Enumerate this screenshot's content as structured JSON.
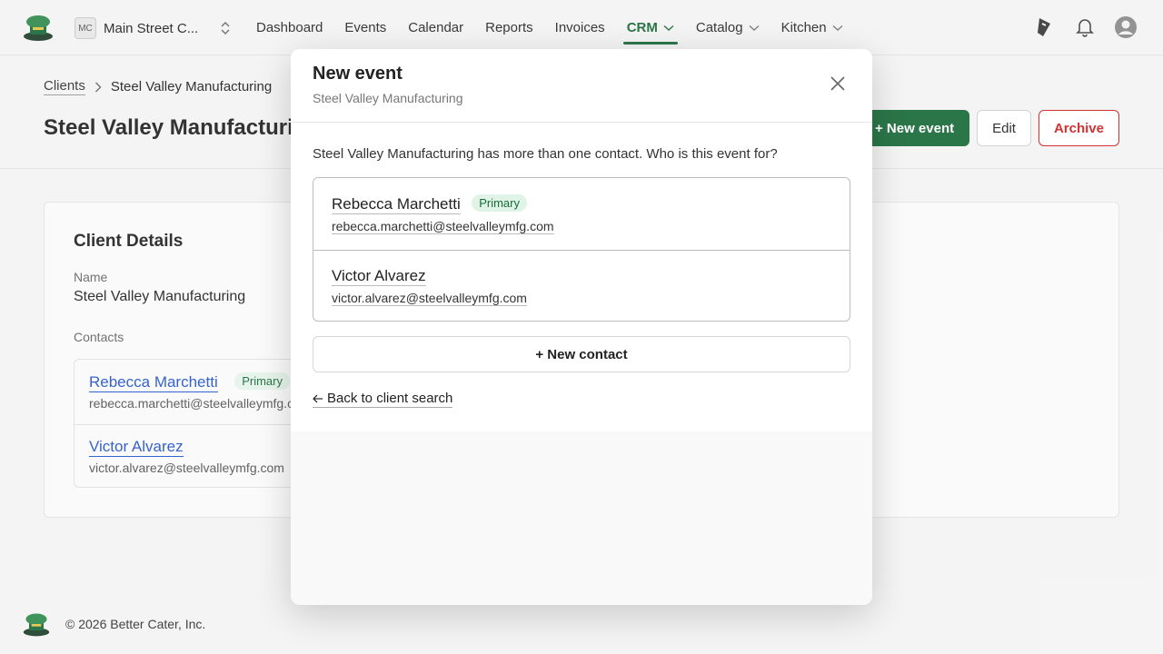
{
  "app": {
    "org_badge": "MC",
    "org_name": "Main Street C...",
    "footer_text": "© 2026 Better Cater, Inc."
  },
  "nav": {
    "items": [
      {
        "label": "Dashboard"
      },
      {
        "label": "Events"
      },
      {
        "label": "Calendar"
      },
      {
        "label": "Reports"
      },
      {
        "label": "Invoices"
      },
      {
        "label": "CRM"
      },
      {
        "label": "Catalog"
      },
      {
        "label": "Kitchen"
      }
    ],
    "active": "CRM"
  },
  "breadcrumb": {
    "parent": "Clients",
    "current": "Steel Valley Manufacturing"
  },
  "page": {
    "title": "Steel Valley Manufacturing",
    "actions": {
      "new_event": "+ New event",
      "edit": "Edit",
      "archive": "Archive"
    }
  },
  "client_card": {
    "title": "Client Details",
    "name_label": "Name",
    "name_value": "Steel Valley Manufacturing",
    "contacts_label": "Contacts",
    "contacts": [
      {
        "name": "Rebecca Marchetti",
        "badge": "Primary",
        "email": "rebecca.marchetti@steelvalleymfg.com"
      },
      {
        "name": "Victor Alvarez",
        "badge": "",
        "email": "victor.alvarez@steelvalleymfg.com"
      }
    ]
  },
  "modal": {
    "title": "New event",
    "subtitle": "Steel Valley Manufacturing",
    "prompt": "Steel Valley Manufacturing has more than one contact. Who is this event for?",
    "choices": [
      {
        "name": "Rebecca Marchetti",
        "badge": "Primary",
        "email": "rebecca.marchetti@steelvalleymfg.com"
      },
      {
        "name": "Victor Alvarez",
        "badge": "",
        "email": "victor.alvarez@steelvalleymfg.com"
      }
    ],
    "new_contact": "+ New contact",
    "back": "Back to client search"
  },
  "colors": {
    "accent": "#1a6b3a",
    "danger": "#cc2222",
    "link": "#2456c9",
    "badge_bg": "#dff3e6"
  },
  "icons": {
    "logo": "chef-hat-logo-icon",
    "org_switch": "chevron-up-down-icon",
    "nav_dropdown": "chevron-down-icon",
    "whats_new": "sparkle-pen-icon",
    "notifications": "bell-icon",
    "account": "user-avatar-icon",
    "close": "close-icon",
    "back": "arrow-left-icon"
  }
}
